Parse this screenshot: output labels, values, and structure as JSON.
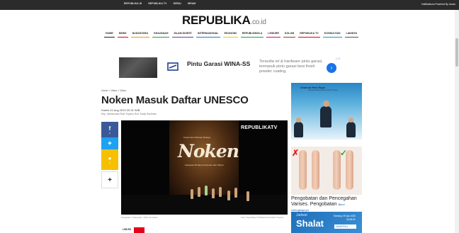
{
  "topbar": {
    "links": [
      "REPUBLIKA.ID",
      "REPUBLIKA TV",
      "GERAI",
      "IHRAM"
    ],
    "notification": "Notifications Powered By  Izooto"
  },
  "logo": {
    "main": "REPUBLIKA",
    "suffix": ".co.id"
  },
  "nav": {
    "items": [
      {
        "label": "HOME",
        "color": "#222222"
      },
      {
        "label": "NEWS",
        "color": "#e3001b"
      },
      {
        "label": "NUSANTARA",
        "color": "#f39200"
      },
      {
        "label": "KHAZANAH",
        "color": "#1d9e48"
      },
      {
        "label": "ISLAM DIGEST",
        "color": "#6c3b9c"
      },
      {
        "label": "INTERNASIONAL",
        "color": "#1a73e8"
      },
      {
        "label": "EKONOMI",
        "color": "#f6c000"
      },
      {
        "label": "REPUBLIKBOLA",
        "color": "#0aa34a"
      },
      {
        "label": "LEISURE",
        "color": "#e4007c"
      },
      {
        "label": "KOLOM",
        "color": "#7b4a2a"
      },
      {
        "label": "REPUBLIKA TV",
        "color": "#e3001b"
      },
      {
        "label": "KONSULTASI",
        "color": "#00a0c6"
      },
      {
        "label": "LAINNYA",
        "color": "#555555"
      }
    ]
  },
  "ad": {
    "title": "Pintu Garasi WINA-SS",
    "description": "Tersedia rel & hardware pintu garasi, termasuk pintu garasi besi finish powder coating."
  },
  "article": {
    "breadcrumb": "Home > Video > Video",
    "title": "Noken Masuk Daftar UNESCO",
    "date": "Kamis 01 Aug 2019 20:31 WIB",
    "author": "Rep: Muhammad Rizki Triyana/ Red: Sadly Rachman",
    "caption_left": "Fotografer: Videografi - Rizki Gunawan",
    "caption_right": "Foto: Republika TV/Muhammad Rizki Triyana",
    "tag_label": "LINKED"
  },
  "share": {
    "facebook_count": "0",
    "twitter_count": "0",
    "comment_count": "0",
    "more_label": "+"
  },
  "video": {
    "watermark": "REPUBLIKATV",
    "poster_title": "Noken",
    "poster_subtitle": "Kreasi Seni Warisan Budaya",
    "poster_sub2": "Kekayaan Budaya Nusantara dari Papua"
  },
  "sidebar": {
    "banner1_title": "Selamat Hari Raya",
    "banner1_sub": "Keluarga Besar Pemerintah Provinsi",
    "banner2_text": "Pengobatan dan Pencegahan Varises. Pengobatan",
    "banner2_link": "Baca selengkapnya",
    "banner3_title": "Jadwal",
    "banner3_big": "Shalat",
    "banner3_date": "Monday, 09 Apr 2020",
    "banner3_time": "04:26:31",
    "banner3_city": "JAKARTA"
  }
}
